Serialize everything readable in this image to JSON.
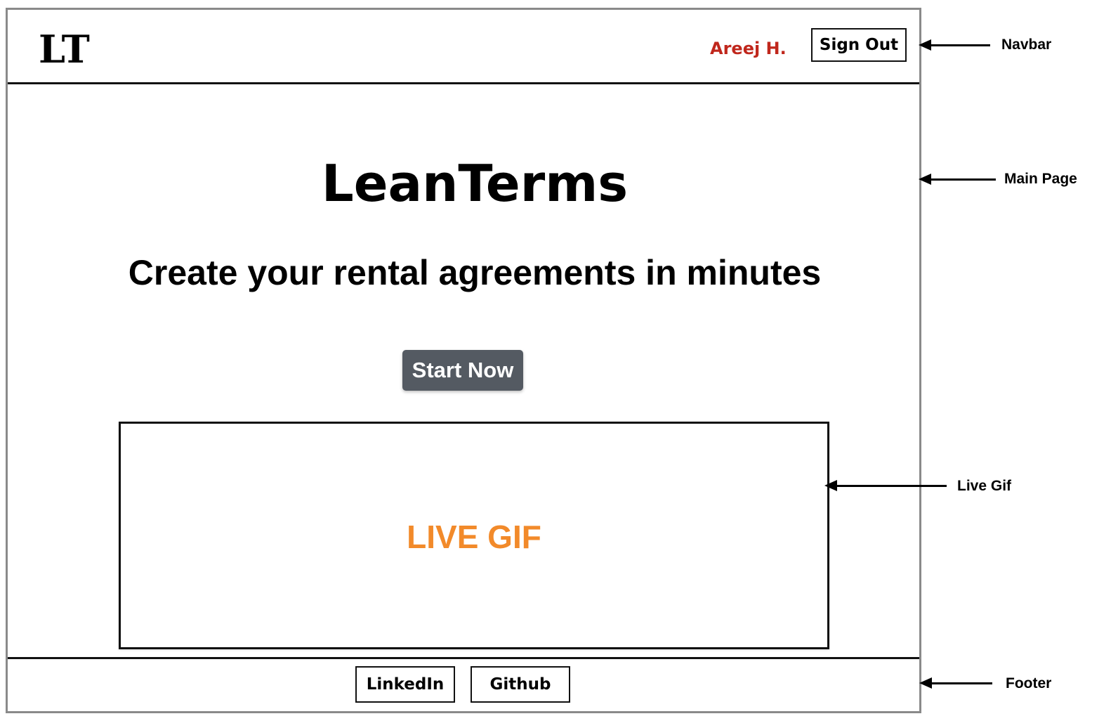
{
  "navbar": {
    "logo": "LT",
    "user_name": "Areej H.",
    "sign_out_label": "Sign Out"
  },
  "main": {
    "title": "LeanTerms",
    "subtitle": "Create your rental agreements in minutes",
    "start_button_label": "Start Now",
    "gif_placeholder": "LIVE GIF"
  },
  "footer": {
    "links": [
      {
        "label": "LinkedIn"
      },
      {
        "label": "Github"
      }
    ]
  },
  "annotations": {
    "navbar": "Navbar",
    "main_page": "Main Page",
    "live_gif": "Live Gif",
    "footer": "Footer"
  },
  "colors": {
    "user_name": "#c0271c",
    "start_button": "#545a62",
    "gif_label": "#f28a2a",
    "frame_border": "#8a8a8a"
  }
}
